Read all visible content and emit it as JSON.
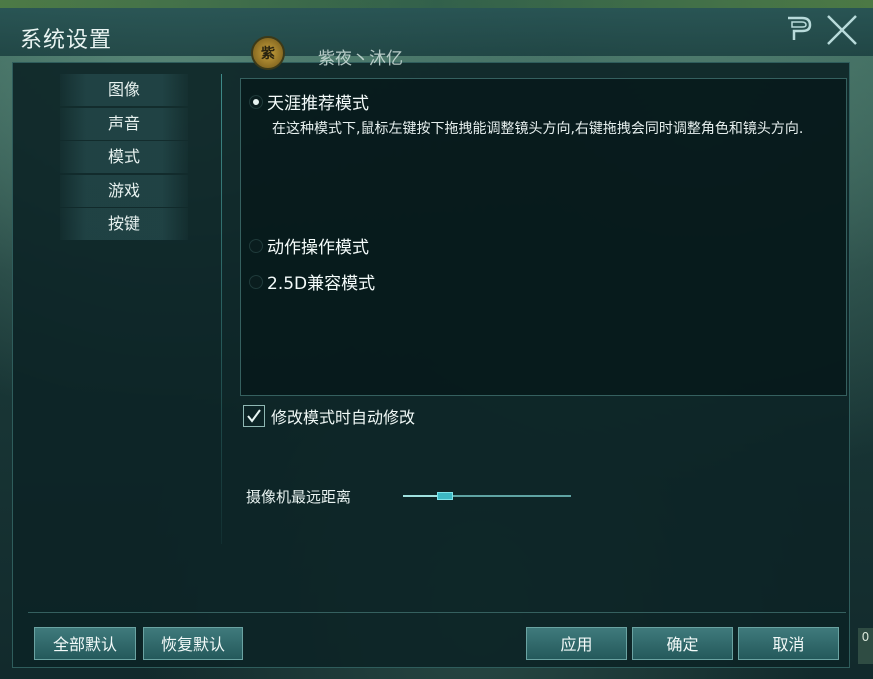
{
  "window": {
    "title": "系统设置"
  },
  "character": {
    "badge": "紫",
    "name": "紫夜丶沐亿"
  },
  "nav": {
    "items": [
      {
        "label": "图像"
      },
      {
        "label": "声音"
      },
      {
        "label": "模式"
      },
      {
        "label": "游戏"
      },
      {
        "label": "按键"
      }
    ]
  },
  "mode": {
    "options": [
      {
        "label": "天涯推荐模式",
        "selected": true
      },
      {
        "label": "动作操作模式",
        "selected": false
      },
      {
        "label": "2.5D兼容模式",
        "selected": false
      }
    ],
    "description": "在这种模式下,鼠标左键按下拖拽能调整镜头方向,右键拖拽会同时调整角色和镜头方向."
  },
  "auto_modify": {
    "label": "修改模式时自动修改",
    "checked": true
  },
  "camera": {
    "label": "摄像机最远距离",
    "value_fraction": 0.25
  },
  "buttons": {
    "reset_all": "全部默认",
    "restore_default": "恢复默认",
    "apply": "应用",
    "confirm": "确定",
    "cancel": "取消"
  },
  "side_badge": "0",
  "colors": {
    "accent": "#3db8c4",
    "panel": "#0c2426",
    "button": "#2d6668"
  },
  "icons": {
    "close": "close-icon",
    "logo": "game-logo-icon",
    "check": "checkmark-icon"
  }
}
